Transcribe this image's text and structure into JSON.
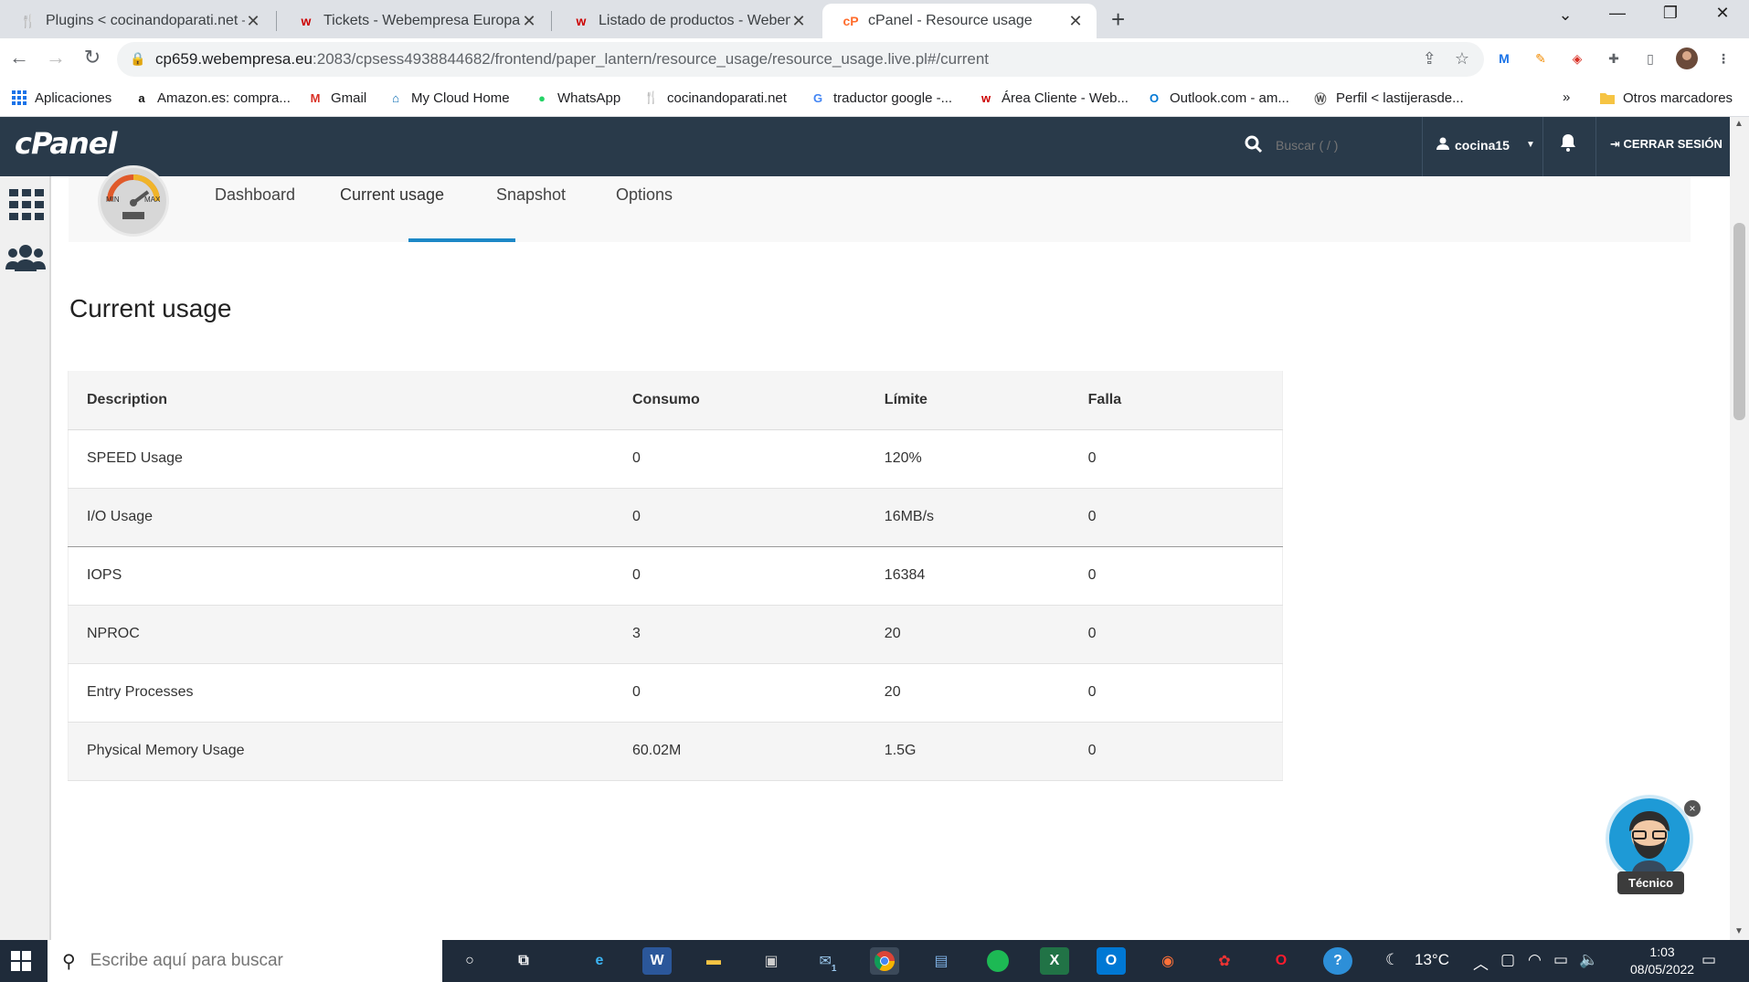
{
  "browser": {
    "tabs": [
      {
        "title": "Plugins < cocinandoparati.net —",
        "favicon": "recipe-favicon",
        "active": false
      },
      {
        "title": "Tickets - Webempresa Europa S.L",
        "favicon": "webempresa-favicon",
        "active": false
      },
      {
        "title": "Listado de productos - Webemp",
        "favicon": "webempresa-favicon",
        "active": false
      },
      {
        "title": "cPanel - Resource usage",
        "favicon": "cpanel-favicon",
        "active": true
      }
    ],
    "url_host": "cp659.webempresa.eu",
    "url_path": ":2083/cpsess4938844682/frontend/paper_lantern/resource_usage/resource_usage.live.pl#/current",
    "bookmarks": [
      {
        "label": "Aplicaciones",
        "icon": "apps-grid-icon"
      },
      {
        "label": "Amazon.es: compra...",
        "icon": "amazon-icon"
      },
      {
        "label": "Gmail",
        "icon": "gmail-icon"
      },
      {
        "label": "My Cloud Home",
        "icon": "cloud-home-icon"
      },
      {
        "label": "WhatsApp",
        "icon": "whatsapp-icon"
      },
      {
        "label": "cocinandoparati.net",
        "icon": "recipe-icon"
      },
      {
        "label": "traductor google -...",
        "icon": "google-icon"
      },
      {
        "label": "Área Cliente - Web...",
        "icon": "webempresa-icon"
      },
      {
        "label": "Outlook.com - am...",
        "icon": "outlook-icon"
      },
      {
        "label": "Perfil < lastijerasde...",
        "icon": "wordpress-icon"
      }
    ],
    "other_bookmarks": "Otros marcadores",
    "overflow": "»"
  },
  "cpanel": {
    "logo": "cPanel",
    "search_placeholder": "Buscar ( / )",
    "username": "cocina15",
    "logout": "CERRAR SESIÓN",
    "subnav": {
      "tabs": [
        "Dashboard",
        "Current usage",
        "Snapshot",
        "Options"
      ],
      "active": "Current usage",
      "gauge_min": "MIN",
      "gauge_max": "MAX"
    },
    "page_title": "Current usage",
    "table": {
      "headers": [
        "Description",
        "Consumo",
        "Límite",
        "Falla"
      ],
      "rows": [
        [
          "SPEED Usage",
          "0",
          "120%",
          "0"
        ],
        [
          "I/O Usage",
          "0",
          "16MB/s",
          "0"
        ],
        [
          "IOPS",
          "0",
          "16384",
          "0"
        ],
        [
          "NPROC",
          "3",
          "20",
          "0"
        ],
        [
          "Entry Processes",
          "0",
          "20",
          "0"
        ],
        [
          "Physical Memory Usage",
          "60.02M",
          "1.5G",
          "0"
        ]
      ]
    },
    "chatbot_label": "Técnico",
    "chatbot_close": "×"
  },
  "taskbar": {
    "search_placeholder": "Escribe aquí para buscar",
    "temperature": "13°C",
    "time": "1:03",
    "date": "08/05/2022",
    "mail_badge": "1"
  }
}
